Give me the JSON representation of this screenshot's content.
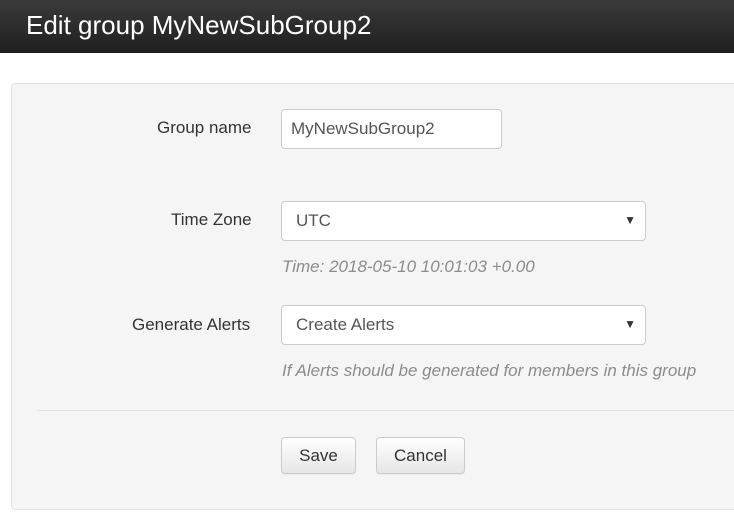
{
  "header": {
    "title": "Edit group MyNewSubGroup2"
  },
  "form": {
    "group_name": {
      "label": "Group name",
      "value": "MyNewSubGroup2"
    },
    "time_zone": {
      "label": "Time Zone",
      "selected": "UTC",
      "help": "Time: 2018-05-10 10:01:03 +0.00"
    },
    "generate_alerts": {
      "label": "Generate Alerts",
      "selected": "Create Alerts",
      "help": "If Alerts should be generated for members in this group"
    },
    "caret_glyph": "▼",
    "save_label": "Save",
    "cancel_label": "Cancel"
  },
  "colors": {
    "header_bg": "#262626",
    "panel_bg": "#f5f5f5",
    "help_text": "#8c8c8c"
  }
}
